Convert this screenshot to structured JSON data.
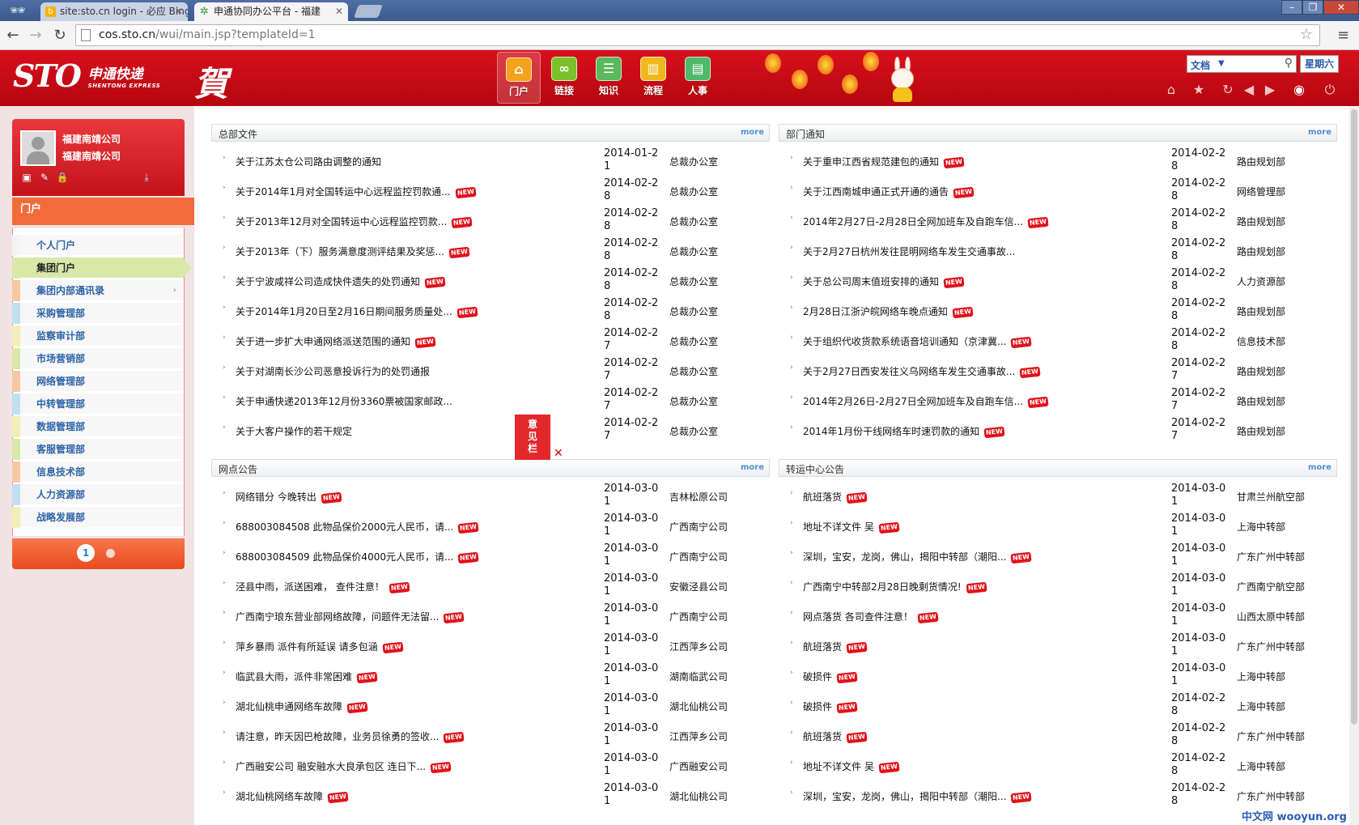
{
  "browser": {
    "tabs": [
      {
        "label": "site:sto.cn login - 必应 Bing",
        "active": false,
        "icon": "bing-icon"
      },
      {
        "label": "申通协同办公平台 - 福建",
        "active": true,
        "icon": "sto-gear-icon"
      }
    ],
    "url_host": "cos.sto.cn",
    "url_path": "/wui/main.jsp?templateId=1"
  },
  "header": {
    "logo_text": "STO",
    "logo_cn": "申通快递",
    "logo_en": "SHENTONG EXPRESS",
    "greeting_char": "賀",
    "nav": [
      {
        "label": "门户",
        "icon": "home-icon",
        "active": true,
        "color": "#f3a21c"
      },
      {
        "label": "链接",
        "icon": "link-icon",
        "active": false,
        "color": "#7bbf2a"
      },
      {
        "label": "知识",
        "icon": "knowledge-icon",
        "active": false,
        "color": "#5cb85c"
      },
      {
        "label": "流程",
        "icon": "workflow-icon",
        "active": false,
        "color": "#f0b81c"
      },
      {
        "label": "人事",
        "icon": "personnel-icon",
        "active": false,
        "color": "#4fb86a"
      }
    ],
    "search_select": "文档",
    "weekday": "星期六"
  },
  "sidebar": {
    "company_line1": "福建南靖公司",
    "company_line2": "福建南靖公司",
    "section_title": "门户",
    "items": [
      {
        "label": "个人门户",
        "stripe": "#f4f4f4"
      },
      {
        "label": "集团门户",
        "stripe": "#d9e8a9",
        "active": true
      },
      {
        "label": "集团内部通讯录",
        "stripe": "#f7c7a3",
        "arrow": "›"
      },
      {
        "label": "采购管理部",
        "stripe": "#bfe0f2"
      },
      {
        "label": "监察审计部",
        "stripe": "#f2efb6"
      },
      {
        "label": "市场营销部",
        "stripe": "#d9e8a9"
      },
      {
        "label": "网络管理部",
        "stripe": "#f7c7a3"
      },
      {
        "label": "中转管理部",
        "stripe": "#bfe0f2"
      },
      {
        "label": "数据管理部",
        "stripe": "#f2efb6"
      },
      {
        "label": "客服管理部",
        "stripe": "#d9e8a9"
      },
      {
        "label": "信息技术部",
        "stripe": "#f7c7a3"
      },
      {
        "label": "人力资源部",
        "stripe": "#bfe0f2"
      },
      {
        "label": "战略发展部",
        "stripe": "#f2efb6"
      }
    ],
    "page_current": "1"
  },
  "panels": {
    "hq_docs": {
      "title": "总部文件",
      "more": "more",
      "rows": [
        {
          "title": "关于江苏太仓公司路由调整的通知",
          "new": false,
          "date": "2014-01-21",
          "dept": "总裁办公室"
        },
        {
          "title": "关于2014年1月对全国转运中心远程监控罚款通...",
          "new": true,
          "date": "2014-02-28",
          "dept": "总裁办公室"
        },
        {
          "title": "关于2013年12月对全国转运中心远程监控罚款...",
          "new": true,
          "date": "2014-02-28",
          "dept": "总裁办公室"
        },
        {
          "title": "关于2013年（下）服务满意度测评结果及奖惩...",
          "new": true,
          "date": "2014-02-28",
          "dept": "总裁办公室"
        },
        {
          "title": "关于宁波咸祥公司造成快件遗失的处罚通知",
          "new": true,
          "date": "2014-02-28",
          "dept": "总裁办公室"
        },
        {
          "title": "关于2014年1月20日至2月16日期间服务质量处...",
          "new": true,
          "date": "2014-02-28",
          "dept": "总裁办公室"
        },
        {
          "title": "关于进一步扩大申通网络派送范围的通知",
          "new": true,
          "date": "2014-02-27",
          "dept": "总裁办公室"
        },
        {
          "title": "关于对湖南长沙公司恶意投诉行为的处罚通报",
          "new": false,
          "date": "2014-02-27",
          "dept": "总裁办公室"
        },
        {
          "title": "关于申通快递2013年12月份3360票被国家邮政...",
          "new": false,
          "date": "2014-02-27",
          "dept": "总裁办公室"
        },
        {
          "title": "关于大客户操作的若干规定",
          "new": false,
          "date": "2014-02-27",
          "dept": "总裁办公室"
        }
      ]
    },
    "dept_notices": {
      "title": "部门通知",
      "more": "more",
      "rows": [
        {
          "title": "关于重申江西省规范建包的通知",
          "new": true,
          "date": "2014-02-28",
          "dept": "路由规划部"
        },
        {
          "title": "关于江西南城申通正式开通的通告",
          "new": true,
          "date": "2014-02-28",
          "dept": "网络管理部"
        },
        {
          "title": "2014年2月27日-2月28日全网加班车及自跑车信...",
          "new": true,
          "date": "2014-02-28",
          "dept": "路由规划部"
        },
        {
          "title": "关于2月27日杭州发往昆明网络车发生交通事故...",
          "new": false,
          "date": "2014-02-28",
          "dept": "路由规划部"
        },
        {
          "title": "关于总公司周末值班安排的通知",
          "new": true,
          "date": "2014-02-28",
          "dept": "人力资源部"
        },
        {
          "title": "2月28日江浙沪皖网络车晚点通知",
          "new": true,
          "date": "2014-02-28",
          "dept": "路由规划部"
        },
        {
          "title": "关于组织代收货款系统语音培训通知（京津冀...",
          "new": true,
          "date": "2014-02-28",
          "dept": "信息技术部"
        },
        {
          "title": "关于2月27日西安发往义乌网络车发生交通事故...",
          "new": true,
          "date": "2014-02-27",
          "dept": "路由规划部"
        },
        {
          "title": "2014年2月26日-2月27日全网加班车及自跑车信...",
          "new": true,
          "date": "2014-02-27",
          "dept": "路由规划部"
        },
        {
          "title": "2014年1月份干线网络车时速罚款的通知",
          "new": true,
          "date": "2014-02-27",
          "dept": "路由规划部"
        }
      ]
    },
    "outlet_notices": {
      "title": "网点公告",
      "more": "more",
      "rows": [
        {
          "title": "网络错分 今晚转出",
          "new": true,
          "date": "2014-03-01",
          "dept": "吉林松原公司"
        },
        {
          "title": "688003084508 此物品保价2000元人民币，请...",
          "new": true,
          "date": "2014-03-01",
          "dept": "广西南宁公司"
        },
        {
          "title": "688003084509 此物品保价4000元人民币，请...",
          "new": true,
          "date": "2014-03-01",
          "dept": "广西南宁公司"
        },
        {
          "title": "泾县中雨，派送困难， 查件注意！",
          "new": true,
          "date": "2014-03-01",
          "dept": "安徽泾县公司"
        },
        {
          "title": "广西南宁琅东营业部网络故障，问题件无法留...",
          "new": true,
          "date": "2014-03-01",
          "dept": "广西南宁公司"
        },
        {
          "title": "萍乡暴雨 派件有所延误 请多包涵",
          "new": true,
          "date": "2014-03-01",
          "dept": "江西萍乡公司"
        },
        {
          "title": "临武县大雨，派件非常困难",
          "new": true,
          "date": "2014-03-01",
          "dept": "湖南临武公司"
        },
        {
          "title": "湖北仙桃申通网络车故障",
          "new": true,
          "date": "2014-03-01",
          "dept": "湖北仙桃公司"
        },
        {
          "title": "请注意，昨天因巴枪故障，业务员徐勇的签收...",
          "new": true,
          "date": "2014-03-01",
          "dept": "江西萍乡公司"
        },
        {
          "title": "广西融安公司 融安融水大良承包区 连日下...",
          "new": true,
          "date": "2014-03-01",
          "dept": "广西融安公司"
        },
        {
          "title": "湖北仙桃网络车故障",
          "new": true,
          "date": "2014-03-01",
          "dept": "湖北仙桃公司"
        }
      ]
    },
    "hub_notices": {
      "title": "转运中心公告",
      "more": "more",
      "rows": [
        {
          "title": "航班落货",
          "new": true,
          "date": "2014-03-01",
          "dept": "甘肃兰州航空部"
        },
        {
          "title": "地址不详文件 吴",
          "new": true,
          "date": "2014-03-01",
          "dept": "上海中转部"
        },
        {
          "title": "深圳，宝安，龙岗，佛山，揭阳中转部（潮阳...",
          "new": true,
          "date": "2014-03-01",
          "dept": "广东广州中转部"
        },
        {
          "title": "广西南宁中转部2月28日晚剩货情况!",
          "new": true,
          "date": "2014-03-01",
          "dept": "广西南宁航空部"
        },
        {
          "title": "网点落货 各司查件注意！",
          "new": true,
          "date": "2014-03-01",
          "dept": "山西太原中转部"
        },
        {
          "title": "航班落货",
          "new": true,
          "date": "2014-03-01",
          "dept": "广东广州中转部"
        },
        {
          "title": "破损件",
          "new": true,
          "date": "2014-03-01",
          "dept": "上海中转部"
        },
        {
          "title": "破损件",
          "new": true,
          "date": "2014-02-28",
          "dept": "上海中转部"
        },
        {
          "title": "航班落货",
          "new": true,
          "date": "2014-02-28",
          "dept": "广东广州中转部"
        },
        {
          "title": "地址不详文件 吴",
          "new": true,
          "date": "2014-02-28",
          "dept": "上海中转部"
        },
        {
          "title": "深圳，宝安，龙岗，佛山，揭阳中转部（潮阳...",
          "new": true,
          "date": "2014-02-28",
          "dept": "广东广州中转部"
        }
      ]
    }
  },
  "new_tag": "NEW",
  "feedback_label": "意见栏",
  "watermark": "中文网 wooyun.org"
}
